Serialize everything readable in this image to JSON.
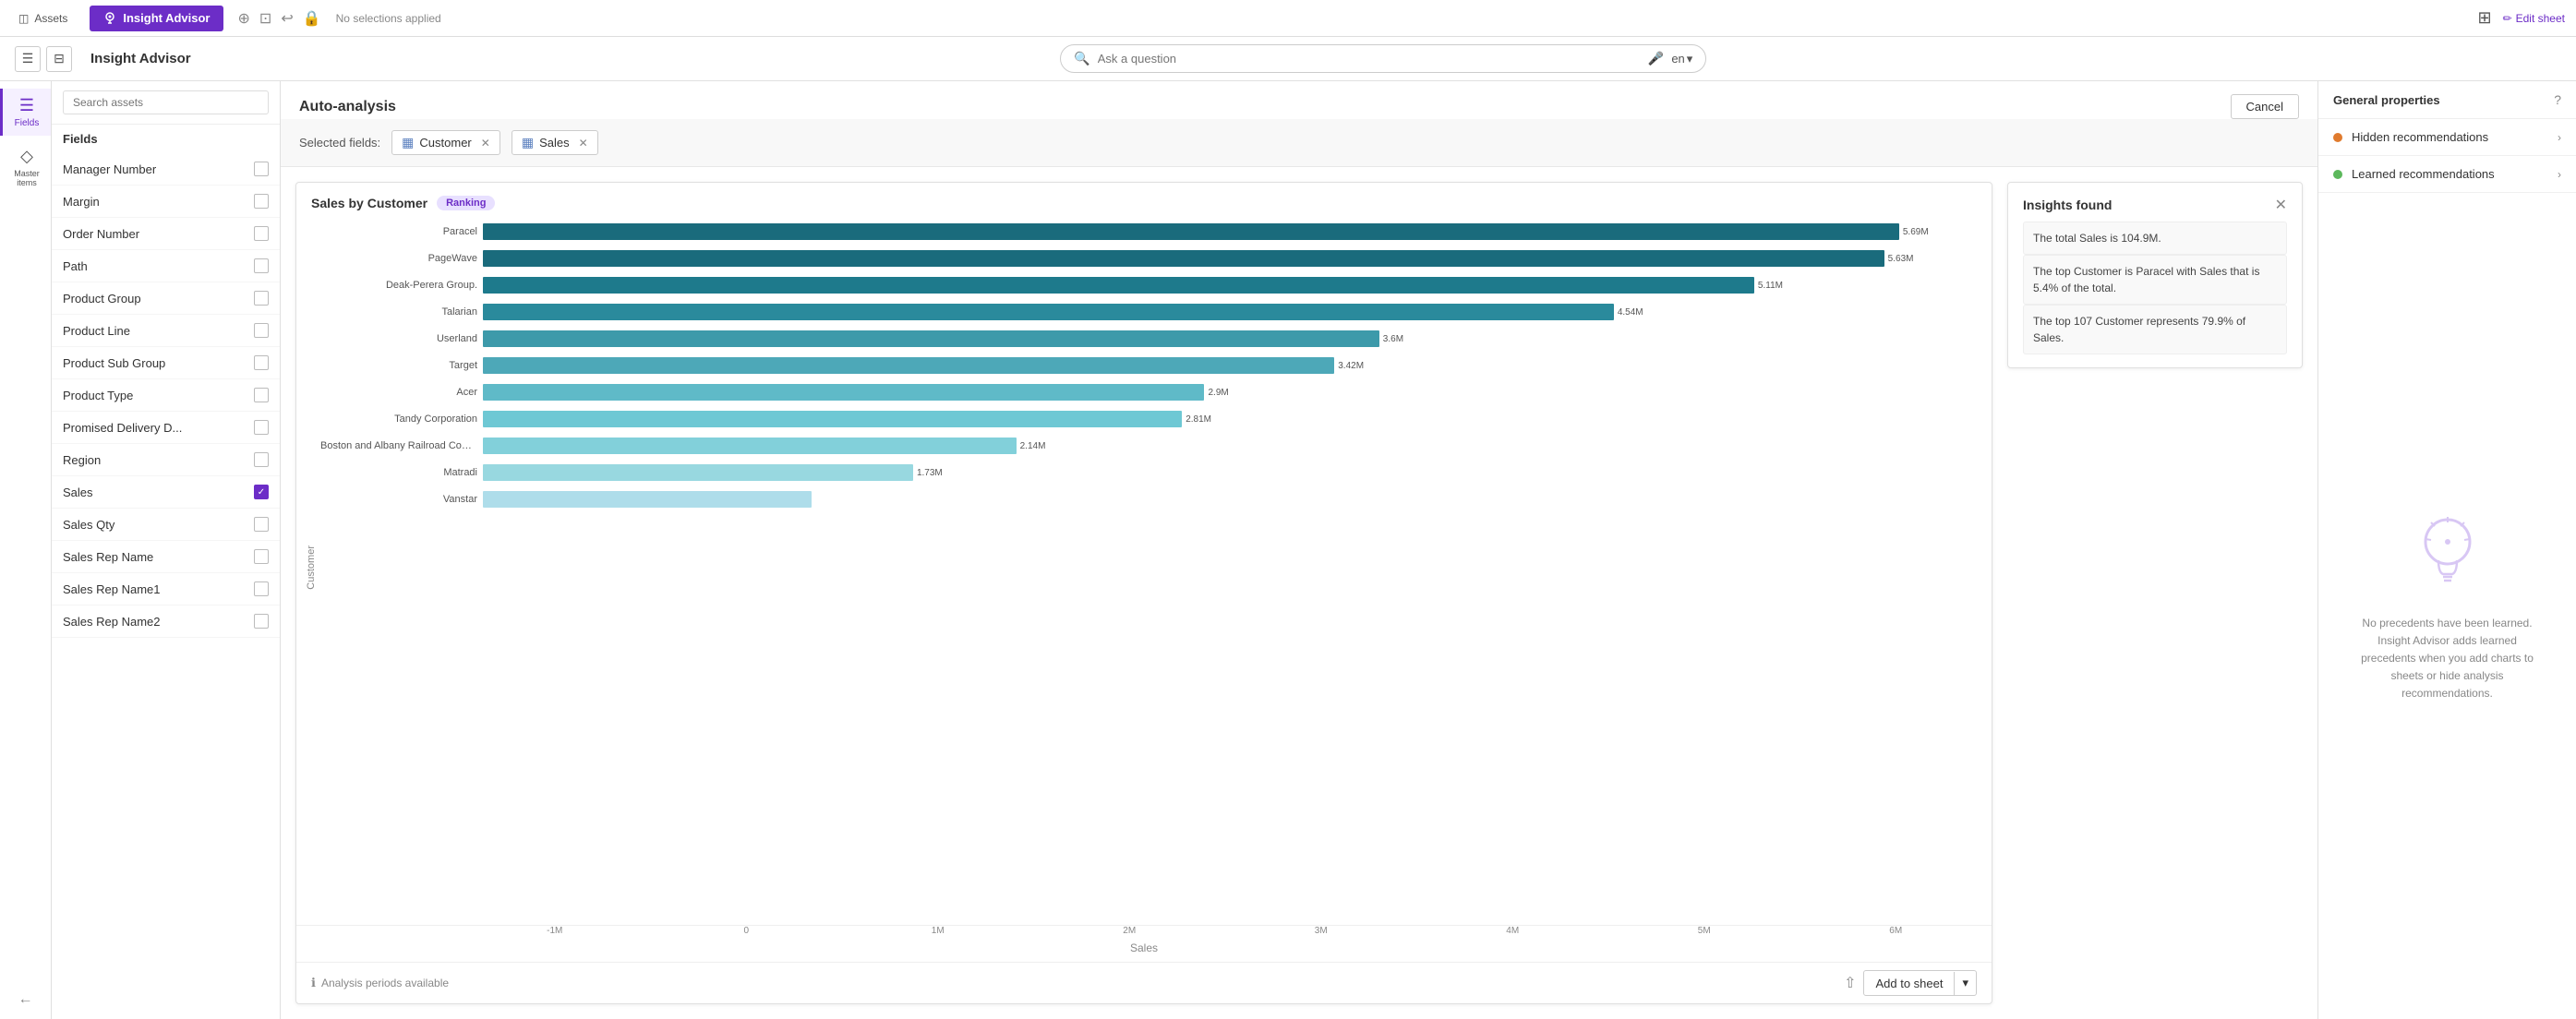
{
  "topNav": {
    "assetsLabel": "Assets",
    "insightTabLabel": "Insight Advisor",
    "noSelectionsLabel": "No selections applied",
    "editSheetLabel": "Edit sheet",
    "gridIconLabel": "⊞"
  },
  "secondRow": {
    "pageTitle": "Insight Advisor",
    "searchPlaceholder": "Ask a question",
    "langLabel": "en"
  },
  "iconSidebar": {
    "fieldsLabel": "Fields",
    "masterItemsLabel": "Master items"
  },
  "fieldsPanel": {
    "searchPlaceholder": "Search assets",
    "panelTitle": "Fields",
    "items": [
      {
        "name": "Manager Number",
        "checked": false
      },
      {
        "name": "Margin",
        "checked": false
      },
      {
        "name": "Order Number",
        "checked": false
      },
      {
        "name": "Path",
        "checked": false
      },
      {
        "name": "Product Group",
        "checked": false
      },
      {
        "name": "Product Line",
        "checked": false
      },
      {
        "name": "Product Sub Group",
        "checked": false
      },
      {
        "name": "Product Type",
        "checked": false
      },
      {
        "name": "Promised Delivery D...",
        "checked": false
      },
      {
        "name": "Region",
        "checked": false
      },
      {
        "name": "Sales",
        "checked": true
      },
      {
        "name": "Sales Qty",
        "checked": false
      },
      {
        "name": "Sales Rep Name",
        "checked": false
      },
      {
        "name": "Sales Rep Name1",
        "checked": false
      },
      {
        "name": "Sales Rep Name2",
        "checked": false
      }
    ]
  },
  "autoAnalysis": {
    "title": "Auto-analysis",
    "cancelLabel": "Cancel",
    "selectedFieldsLabel": "Selected fields:",
    "field1": "Customer",
    "field2": "Sales"
  },
  "chart": {
    "title": "Sales by Customer",
    "badgeLabel": "Ranking",
    "yAxisLabel": "Customer",
    "xAxisLabel": "Sales",
    "xTicks": [
      "-1M",
      "0",
      "1M",
      "2M",
      "3M",
      "4M",
      "5M",
      "6M"
    ],
    "analysisPeriodsLabel": "Analysis periods available",
    "addToSheetLabel": "Add to sheet",
    "bars": [
      {
        "label": "Paracel",
        "value": "5.69M",
        "pct": 94.8
      },
      {
        "label": "PageWave",
        "value": "5.63M",
        "pct": 93.8
      },
      {
        "label": "Deak-Perera Group.",
        "value": "5.11M",
        "pct": 85.1
      },
      {
        "label": "Talarian",
        "value": "4.54M",
        "pct": 75.7
      },
      {
        "label": "Userland",
        "value": "3.6M",
        "pct": 60.0
      },
      {
        "label": "Target",
        "value": "3.42M",
        "pct": 57.0
      },
      {
        "label": "Acer",
        "value": "2.9M",
        "pct": 48.3
      },
      {
        "label": "Tandy Corporation",
        "value": "2.81M",
        "pct": 46.8
      },
      {
        "label": "Boston and Albany Railroad Company",
        "value": "2.14M",
        "pct": 35.7
      },
      {
        "label": "Matradi",
        "value": "1.73M",
        "pct": 28.8
      },
      {
        "label": "Vanstar",
        "value": "",
        "pct": 22.0
      }
    ],
    "barColors": [
      "#1a6b7c",
      "#1a6b7c",
      "#1e7a8c",
      "#2a8a9c",
      "#3d9aaa",
      "#4da8b8",
      "#5fbac8",
      "#6ec8d4",
      "#82d0da",
      "#98d8e0",
      "#aeddea"
    ]
  },
  "insights": {
    "title": "Insights found",
    "items": [
      "The total Sales is 104.9M.",
      "The top Customer is Paracel with Sales that is 5.4% of the total.",
      "The top 107 Customer represents 79.9% of Sales."
    ]
  },
  "rightSidebar": {
    "title": "General properties",
    "hiddenRecsLabel": "Hidden recommendations",
    "learnedRecsLabel": "Learned recommendations",
    "noPrecsText": "No precedents have been learned. Insight Advisor adds learned precedents when you add charts to sheets or hide analysis recommendations."
  }
}
